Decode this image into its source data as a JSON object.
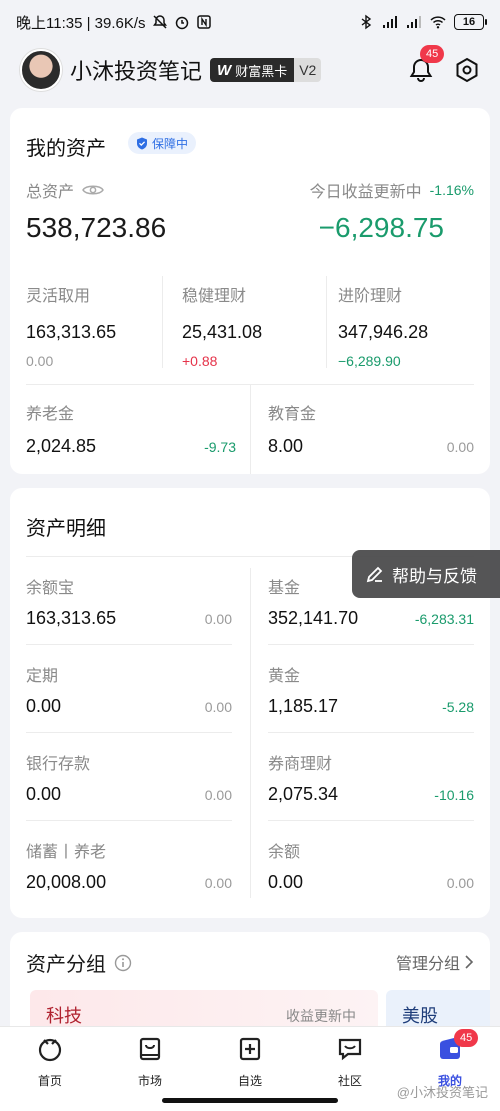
{
  "status_bar": {
    "time_speed": "晚上11:35 | 39.6K/s",
    "battery": "16"
  },
  "header": {
    "username": "小沐投资笔记",
    "vip_label": "财富黑卡",
    "vip_logo": "W",
    "vip_level": "V2",
    "notification_count": "45"
  },
  "assets_card": {
    "title": "我的资产",
    "protect_badge": "保障中",
    "total_label": "总资产",
    "total_value": "538,723.86",
    "today_label": "今日收益更新中",
    "today_pct": "-1.16%",
    "today_value": "−6,298.75",
    "top_row": [
      {
        "label": "灵活取用",
        "value": "163,313.65",
        "delta": "0.00",
        "delta_type": "zero"
      },
      {
        "label": "稳健理财",
        "value": "25,431.08",
        "delta": "+0.88",
        "delta_type": "pos"
      },
      {
        "label": "进阶理财",
        "value": "347,946.28",
        "delta": "−6,289.90",
        "delta_type": "neg"
      }
    ],
    "bottom_row": [
      {
        "label": "养老金",
        "value": "2,024.85",
        "delta": "-9.73",
        "delta_type": "neg"
      },
      {
        "label": "教育金",
        "value": "8.00",
        "delta": "0.00",
        "delta_type": "zero"
      }
    ]
  },
  "detail_card": {
    "title": "资产明细",
    "left": [
      {
        "label": "余额宝",
        "value": "163,313.65",
        "delta": "0.00",
        "delta_type": "zero"
      },
      {
        "label": "定期",
        "value": "0.00",
        "delta": "0.00",
        "delta_type": "zero"
      },
      {
        "label": "银行存款",
        "value": "0.00",
        "delta": "0.00",
        "delta_type": "zero"
      },
      {
        "label": "储蓄丨养老",
        "value": "20,008.00",
        "delta": "0.00",
        "delta_type": "zero"
      }
    ],
    "right": [
      {
        "label": "基金",
        "value": "352,141.70",
        "delta": "-6,283.31",
        "delta_type": "neg"
      },
      {
        "label": "黄金",
        "value": "1,185.17",
        "delta": "-5.28",
        "delta_type": "neg"
      },
      {
        "label": "券商理财",
        "value": "2,075.34",
        "delta": "-10.16",
        "delta_type": "neg"
      },
      {
        "label": "余额",
        "value": "0.00",
        "delta": "0.00",
        "delta_type": "zero"
      }
    ]
  },
  "help_button": "帮助与反馈",
  "group_card": {
    "title": "资产分组",
    "manage_label": "管理分组",
    "chips": [
      {
        "label": "科技",
        "status": "收益更新中"
      },
      {
        "label": "美股"
      }
    ]
  },
  "bottom_nav": {
    "items": [
      {
        "label": "首页"
      },
      {
        "label": "市场"
      },
      {
        "label": "自选"
      },
      {
        "label": "社区"
      },
      {
        "label": "我的"
      }
    ],
    "badge": "45"
  },
  "watermark": "@小沐投资笔记",
  "colors": {
    "negative": "#1a9b6c",
    "positive": "#e5334a",
    "accent": "#3a50e0"
  }
}
